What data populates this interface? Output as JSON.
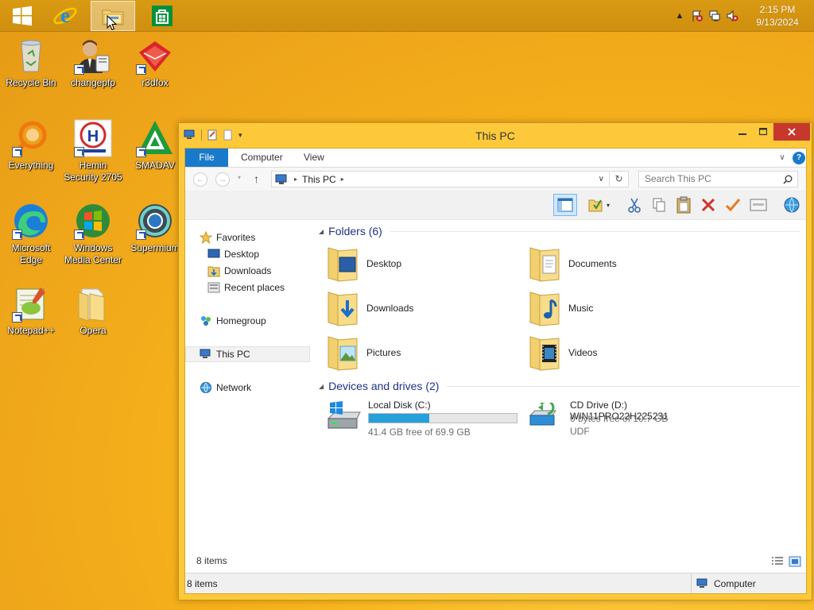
{
  "taskbar": {
    "pinned": [
      {
        "name": "start-button",
        "icon": "windows-logo-icon"
      },
      {
        "name": "internet-explorer-button",
        "icon": "internet-explorer-icon"
      },
      {
        "name": "file-explorer-button",
        "icon": "file-explorer-icon",
        "active": true
      },
      {
        "name": "store-button",
        "icon": "store-icon"
      }
    ],
    "tray": {
      "time": "2:15 PM",
      "date": "9/13/2024",
      "icons": [
        "show-hidden-icons-chevron-icon",
        "action-center-flag-icon",
        "network-icon",
        "volume-muted-icon"
      ]
    }
  },
  "desktop": {
    "icons": [
      {
        "label": "Recycle Bin"
      },
      {
        "label": "changepfp"
      },
      {
        "label": "r3dfox"
      },
      {
        "label": "Everything"
      },
      {
        "label": "Hemin Security 2705"
      },
      {
        "label": "SMADAV"
      },
      {
        "label": "Microsoft Edge"
      },
      {
        "label": "Windows Media Center"
      },
      {
        "label": "Supermium"
      },
      {
        "label": "Notepad++"
      },
      {
        "label": "Opera"
      }
    ]
  },
  "explorer": {
    "title": "This PC",
    "ribbon_tabs": [
      "File",
      "Computer",
      "View"
    ],
    "address": {
      "crumb": "This PC"
    },
    "search_placeholder": "Search This PC",
    "nav": {
      "favorites": "Favorites",
      "desktop": "Desktop",
      "downloads": "Downloads",
      "recent": "Recent places",
      "homegroup": "Homegroup",
      "thispc": "This PC",
      "network": "Network"
    },
    "folders_header": "Folders (6)",
    "folders": [
      {
        "label": "Desktop",
        "icon": "desktop-folder-icon"
      },
      {
        "label": "Documents",
        "icon": "documents-folder-icon"
      },
      {
        "label": "Downloads",
        "icon": "downloads-folder-icon"
      },
      {
        "label": "Music",
        "icon": "music-folder-icon"
      },
      {
        "label": "Pictures",
        "icon": "pictures-folder-icon"
      },
      {
        "label": "Videos",
        "icon": "videos-folder-icon"
      }
    ],
    "drives_header": "Devices and drives (2)",
    "drives": [
      {
        "label": "Local Disk (C:)",
        "free": "41.4 GB free of 69.9 GB",
        "used_fraction": 0.41
      },
      {
        "label": "CD Drive (D:) WIN11PRO22H225231",
        "free": "0 bytes free of 10.7 GB",
        "fs": "UDF"
      }
    ],
    "item_count": "8 items",
    "status_left": "8 items",
    "status_right": "Computer"
  },
  "colors": {
    "accent": "#1979ca",
    "window_frame": "#fdc93a",
    "close_button": "#c7382c",
    "drive_bar": "#26a0da",
    "group_heading": "#1e3287"
  }
}
